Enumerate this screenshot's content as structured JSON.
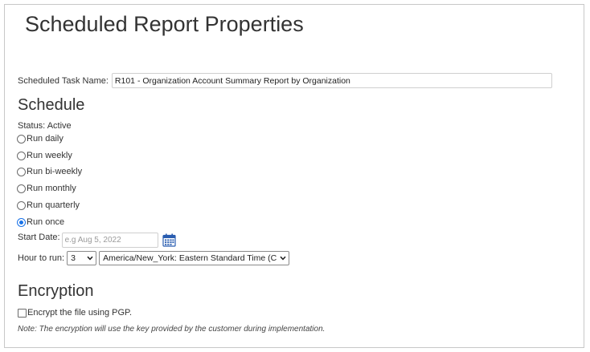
{
  "page": {
    "title": "Scheduled Report Properties"
  },
  "task": {
    "label": "Scheduled Task Name:",
    "value": "R101 - Organization Account Summary Report by Organization"
  },
  "schedule": {
    "heading": "Schedule",
    "status": "Status: Active",
    "options": [
      {
        "label": "Run daily",
        "checked": false
      },
      {
        "label": "Run weekly",
        "checked": false
      },
      {
        "label": "Run bi-weekly",
        "checked": false
      },
      {
        "label": "Run monthly",
        "checked": false
      },
      {
        "label": "Run quarterly",
        "checked": false
      },
      {
        "label": "Run once",
        "checked": true
      }
    ],
    "start_date_label": "Start Date:",
    "start_date_placeholder": "e.g Aug 5, 2022",
    "start_date_value": "",
    "hour_label": "Hour to run:",
    "hour_value": "3",
    "timezone_value": "America/New_York: Eastern Standard Time (C"
  },
  "encryption": {
    "heading": "Encryption",
    "checkbox_label": "Encrypt the file using PGP.",
    "checked": false,
    "note": "Note: The encryption will use the key provided by the customer during implementation."
  },
  "colors": {
    "accent": "#1a73e8",
    "border": "#c8c8c8",
    "text": "#333333"
  },
  "icons": {
    "calendar": "calendar-icon",
    "dropdown": "chevron-down-icon"
  }
}
